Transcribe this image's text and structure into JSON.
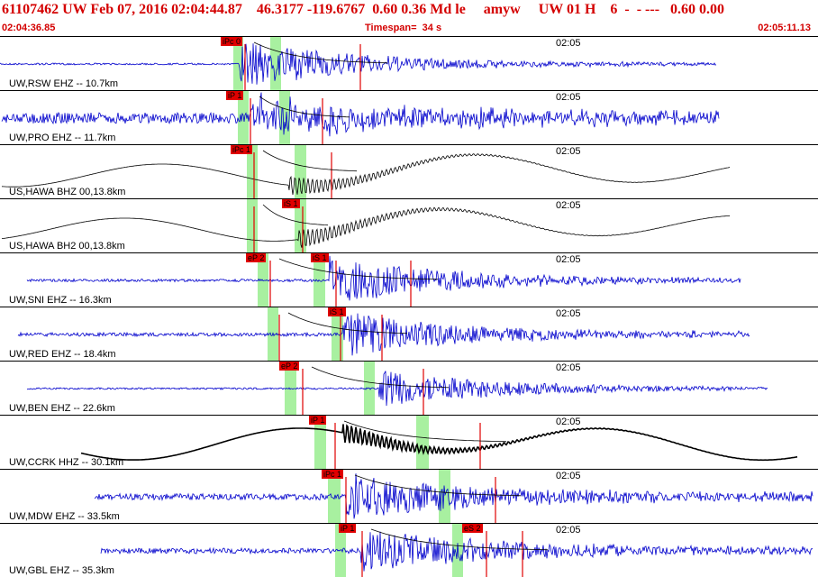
{
  "header": {
    "title": "61107462 UW Feb 07, 2016 02:04:44.87    46.3177 -119.6767  0.60 0.36 Md le     amyw     UW 01 H    6  -  - ---   0.60 0.00",
    "start_time": "02:04:36.85",
    "timespan": "Timespan=  34 s",
    "end_time": "02:05:11.13"
  },
  "colors": {
    "header_text": "#d40000",
    "trace_short_period": "#0000cc",
    "trace_broadband": "#000000",
    "pick_flag": "#e00000",
    "window": "#a8f0a0"
  },
  "tick_label": "02:05",
  "channels": [
    {
      "label": "UW,RSW EHZ -- 10.7km",
      "trace_type": "sp",
      "picks": [
        {
          "text": "iPc 0"
        }
      ]
    },
    {
      "label": "UW,PRO EHZ -- 11.7km",
      "trace_type": "sp",
      "picks": [
        {
          "text": "iP 1"
        }
      ]
    },
    {
      "label": "US,HAWA BHZ 00,13.8km",
      "trace_type": "bb",
      "picks": [
        {
          "text": "iPc 1"
        }
      ]
    },
    {
      "label": "US,HAWA BH2 00,13.8km",
      "trace_type": "bb",
      "picks": [
        {
          "text": "iS 1"
        }
      ]
    },
    {
      "label": "UW,SNI EHZ -- 16.3km",
      "trace_type": "sp",
      "picks": [
        {
          "text": "eP 2"
        },
        {
          "text": "iS 1"
        }
      ]
    },
    {
      "label": "UW,RED EHZ -- 18.4km",
      "trace_type": "sp",
      "picks": [
        {
          "text": "iS 1"
        }
      ]
    },
    {
      "label": "UW,BEN EHZ -- 22.6km",
      "trace_type": "sp",
      "picks": [
        {
          "text": "eP 2"
        }
      ]
    },
    {
      "label": "UW,CCRK HHZ -- 30.1km",
      "trace_type": "bb",
      "picks": [
        {
          "text": "iP 1"
        }
      ]
    },
    {
      "label": "UW,MDW EHZ -- 33.5km",
      "trace_type": "sp",
      "picks": [
        {
          "text": "iPc 1"
        }
      ]
    },
    {
      "label": "UW,GBL EHZ -- 35.3km",
      "trace_type": "sp",
      "picks": [
        {
          "text": "iP 1"
        },
        {
          "text": "eS 2"
        }
      ]
    }
  ]
}
